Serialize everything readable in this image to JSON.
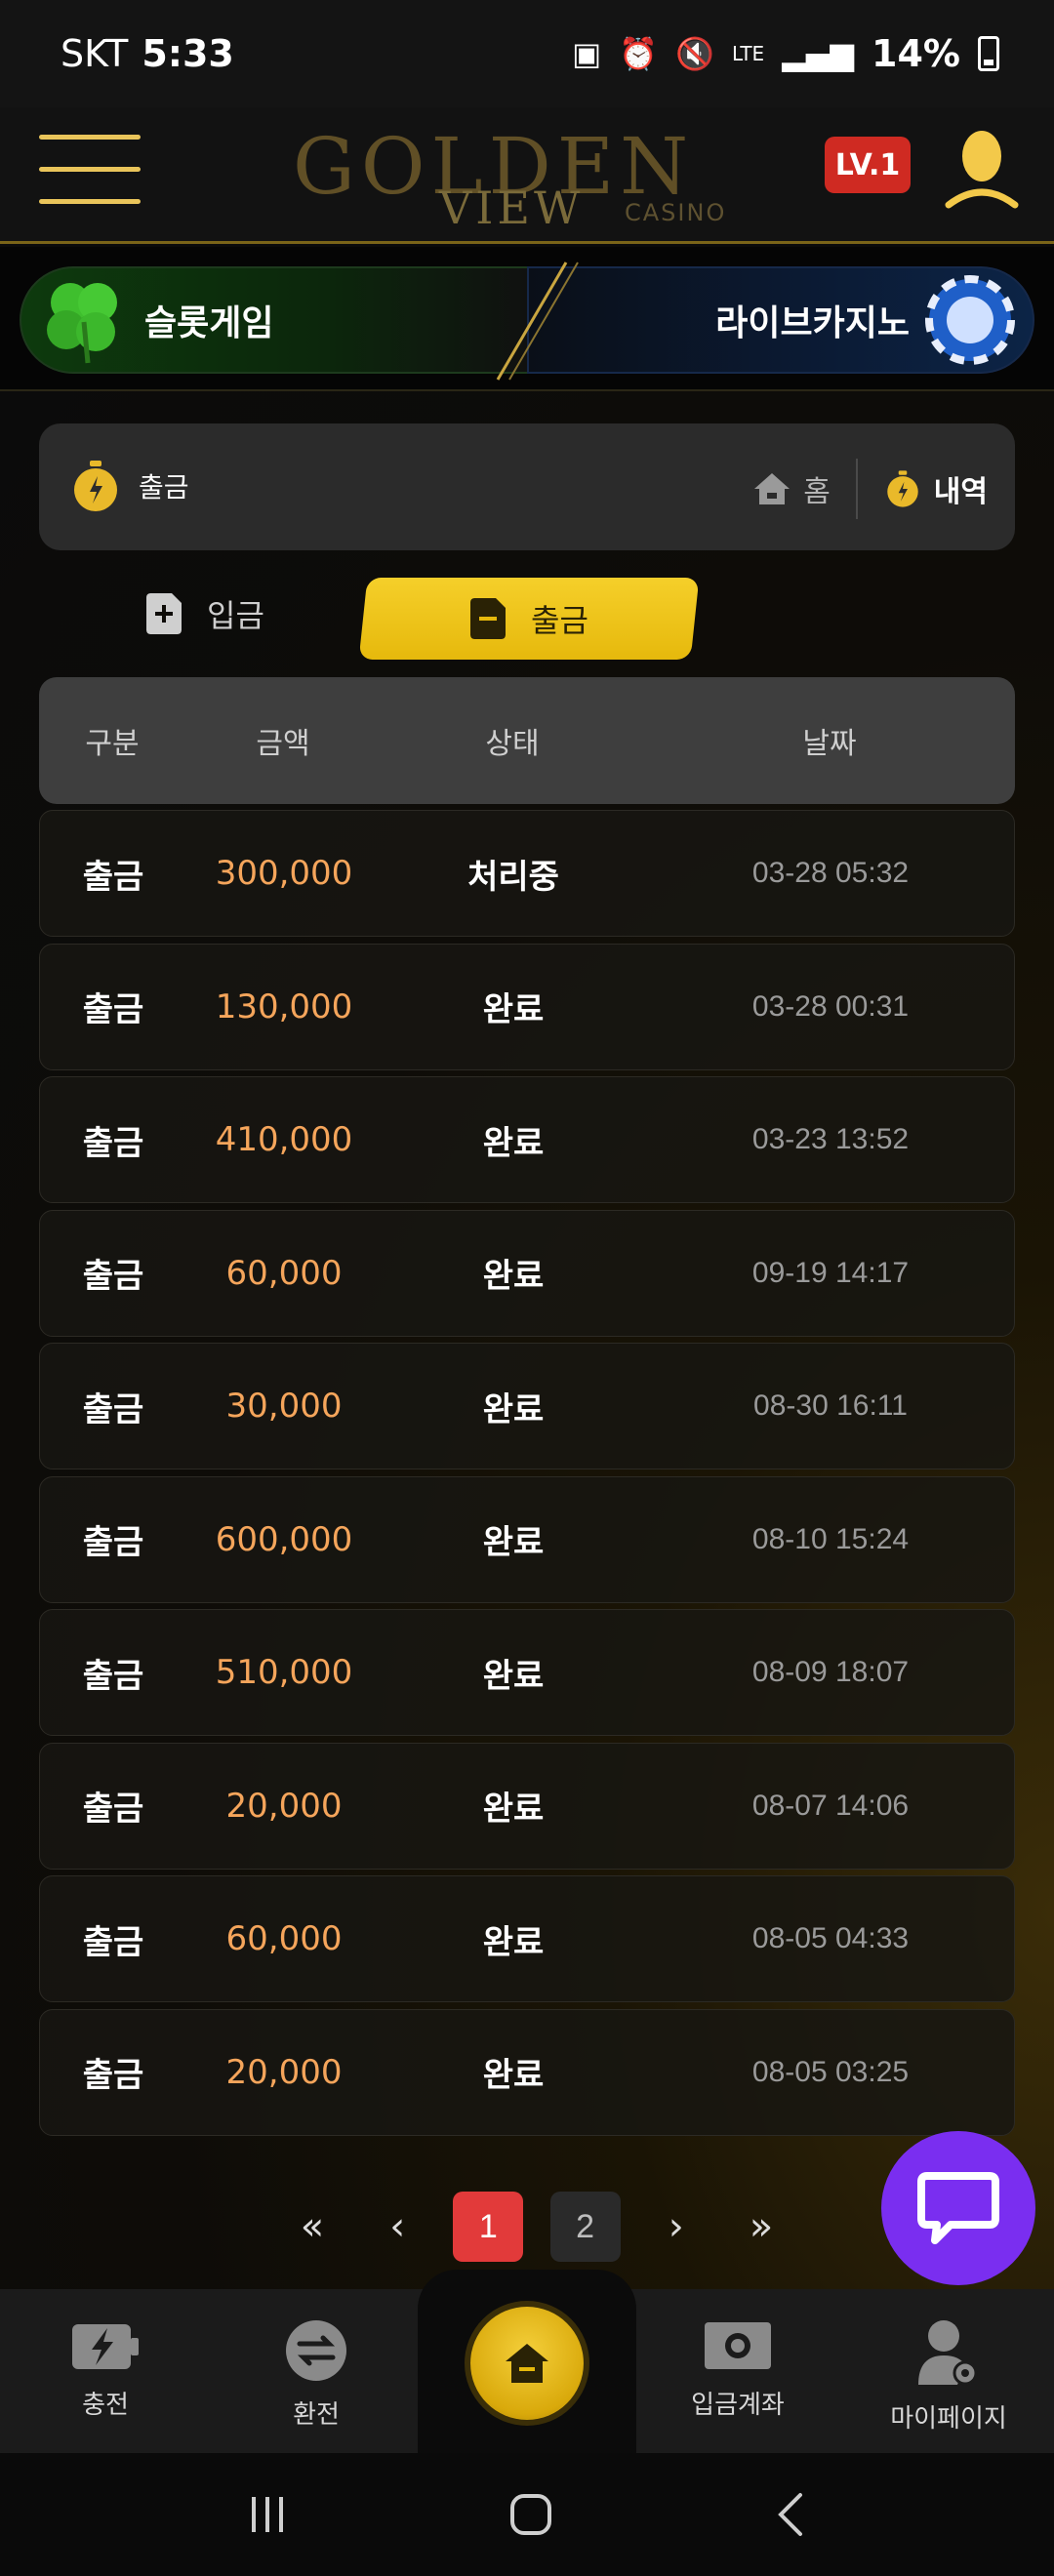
{
  "status_bar": {
    "carrier": "SKT",
    "time": "5:33",
    "network": "LTE",
    "battery": "14%"
  },
  "header": {
    "logo_text_main": "GOLDEN",
    "logo_text_sub": "VIEW",
    "logo_text_casino": "CASINO",
    "level": "LV.1"
  },
  "banner": {
    "slot_label": "슬롯게임",
    "live_label": "라이브카지노"
  },
  "breadcrumb": {
    "title": "출금",
    "home": "홈",
    "history": "내역"
  },
  "tabs": {
    "deposit": "입금",
    "withdraw": "출금"
  },
  "table": {
    "headers": [
      "구분",
      "금액",
      "상태",
      "날짜"
    ],
    "rows": [
      {
        "type": "출금",
        "amount": "300,000",
        "status": "처리중",
        "date": "03-28 05:32"
      },
      {
        "type": "출금",
        "amount": "130,000",
        "status": "완료",
        "date": "03-28 00:31"
      },
      {
        "type": "출금",
        "amount": "410,000",
        "status": "완료",
        "date": "03-23 13:52"
      },
      {
        "type": "출금",
        "amount": "60,000",
        "status": "완료",
        "date": "09-19 14:17"
      },
      {
        "type": "출금",
        "amount": "30,000",
        "status": "완료",
        "date": "08-30 16:11"
      },
      {
        "type": "출금",
        "amount": "600,000",
        "status": "완료",
        "date": "08-10 15:24"
      },
      {
        "type": "출금",
        "amount": "510,000",
        "status": "완료",
        "date": "08-09 18:07"
      },
      {
        "type": "출금",
        "amount": "20,000",
        "status": "완료",
        "date": "08-07 14:06"
      },
      {
        "type": "출금",
        "amount": "60,000",
        "status": "완료",
        "date": "08-05 04:33"
      },
      {
        "type": "출금",
        "amount": "20,000",
        "status": "완료",
        "date": "08-05 03:25"
      }
    ]
  },
  "pagination": {
    "first": "«",
    "prev": "‹",
    "pages": [
      "1",
      "2"
    ],
    "current": "1",
    "next": "›",
    "last": "»"
  },
  "bottom_nav": {
    "charge": "충전",
    "exchange": "환전",
    "deposit_account": "입금계좌",
    "mypage": "마이페이지"
  },
  "colors": {
    "accent_gold": "#f0c419",
    "amount_orange": "#f5a55b",
    "level_red": "#cf2a22",
    "page_active": "#e23a3a",
    "chat_purple": "#7a2ef0"
  }
}
